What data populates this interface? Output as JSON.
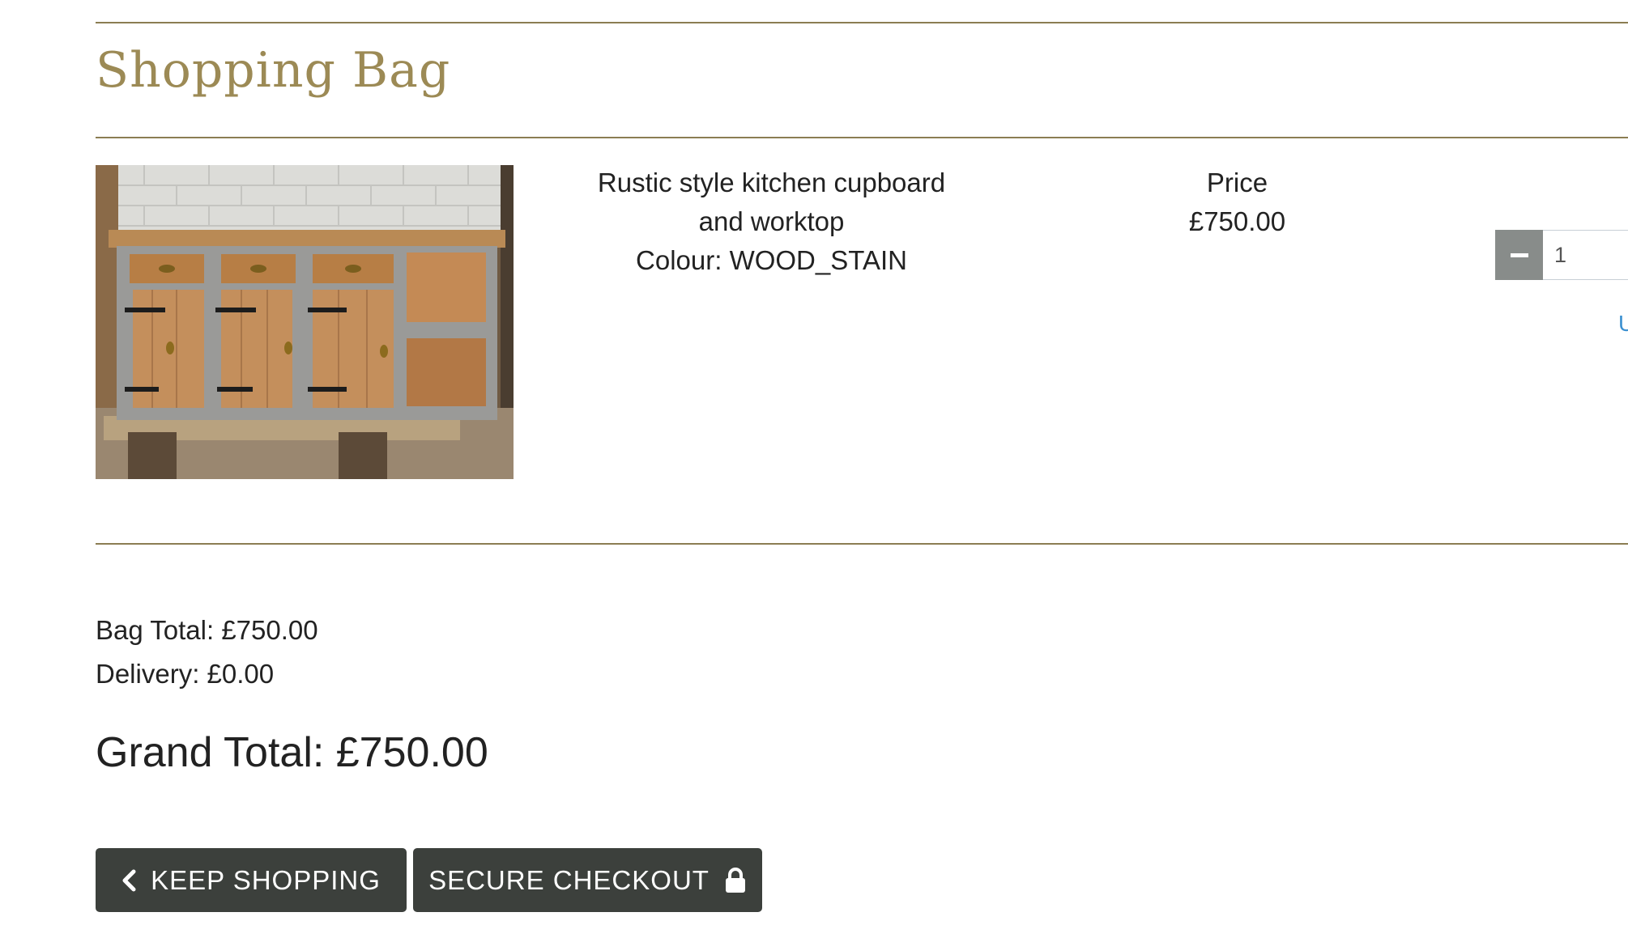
{
  "page": {
    "title": "Shopping Bag"
  },
  "item": {
    "image_alt": "Rustic style kitchen cupboard and worktop",
    "name_line1": "Rustic style kitchen cupboard",
    "name_line2": "and worktop",
    "colour_label": "Colour: WOOD_STAIN",
    "price_label": "Price",
    "price": "£750.00",
    "quantity": "1",
    "update_link": "U"
  },
  "totals": {
    "bag_total": "Bag Total: £750.00",
    "delivery": "Delivery: £0.00",
    "grand_total": "Grand Total: £750.00"
  },
  "buttons": {
    "keep_shopping": "KEEP SHOPPING",
    "secure_checkout": "SECURE CHECKOUT"
  },
  "icons": {
    "keep_shopping": "chevron-left-icon",
    "secure_checkout": "lock-icon",
    "qty_decrement": "minus-icon"
  },
  "colors": {
    "title": "#9c8a55",
    "rule": "#8b7d52",
    "button_bg": "#3c403c",
    "qty_button_bg": "#888c8a",
    "link": "#3a8fd0"
  }
}
